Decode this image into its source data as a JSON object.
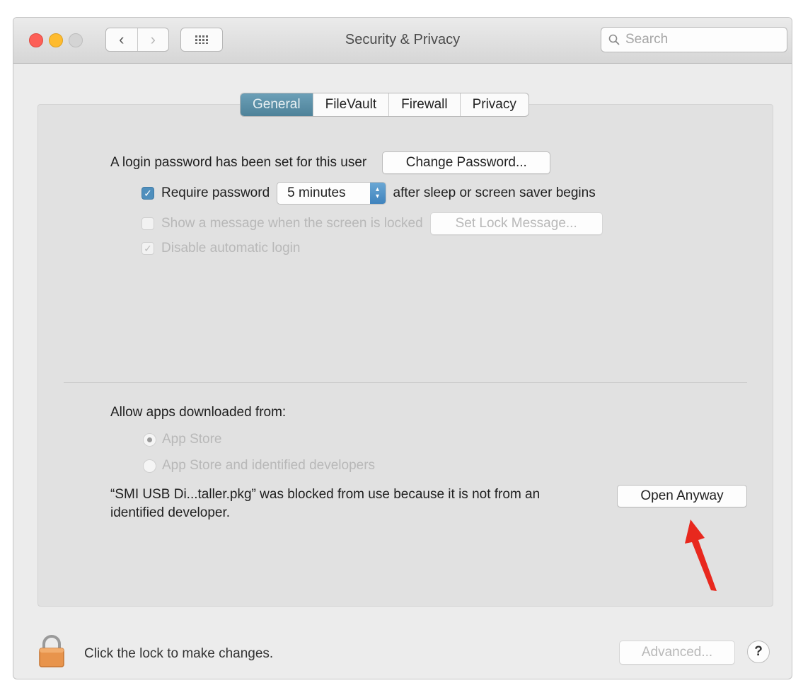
{
  "window": {
    "title": "Security & Privacy"
  },
  "search": {
    "placeholder": "Search"
  },
  "tabs": [
    {
      "label": "General",
      "active": true
    },
    {
      "label": "FileVault",
      "active": false
    },
    {
      "label": "Firewall",
      "active": false
    },
    {
      "label": "Privacy",
      "active": false
    }
  ],
  "general": {
    "login_text": "A login password has been set for this user",
    "change_password_label": "Change Password...",
    "require_password_label": "Require password",
    "require_password_checked": true,
    "require_password_delay": "5 minutes",
    "require_password_suffix": "after sleep or screen saver begins",
    "show_message_label": "Show a message when the screen is locked",
    "show_message_checked": false,
    "set_lock_message_label": "Set Lock Message...",
    "disable_autologin_label": "Disable automatic login",
    "disable_autologin_checked": true
  },
  "gatekeeper": {
    "heading": "Allow apps downloaded from:",
    "options": [
      {
        "label": "App Store",
        "selected": true
      },
      {
        "label": "App Store and identified developers",
        "selected": false
      }
    ],
    "blocked_message": "“SMI USB Di...taller.pkg” was blocked from use because it is not from an identified developer.",
    "open_anyway_label": "Open Anyway"
  },
  "footer": {
    "lock_text": "Click the lock to make changes.",
    "advanced_label": "Advanced...",
    "help_label": "?"
  },
  "icons": {
    "back": "chevron-left-icon",
    "forward": "chevron-right-icon",
    "grid": "grid-icon",
    "search": "search-icon",
    "lock": "lock-icon",
    "annotation": "red-arrow-icon"
  },
  "colors": {
    "accent_tab": "#5a8ea6",
    "checkbox": "#4f8fbd",
    "annotation_arrow": "#e8281e",
    "watermark": "#f5c200"
  }
}
